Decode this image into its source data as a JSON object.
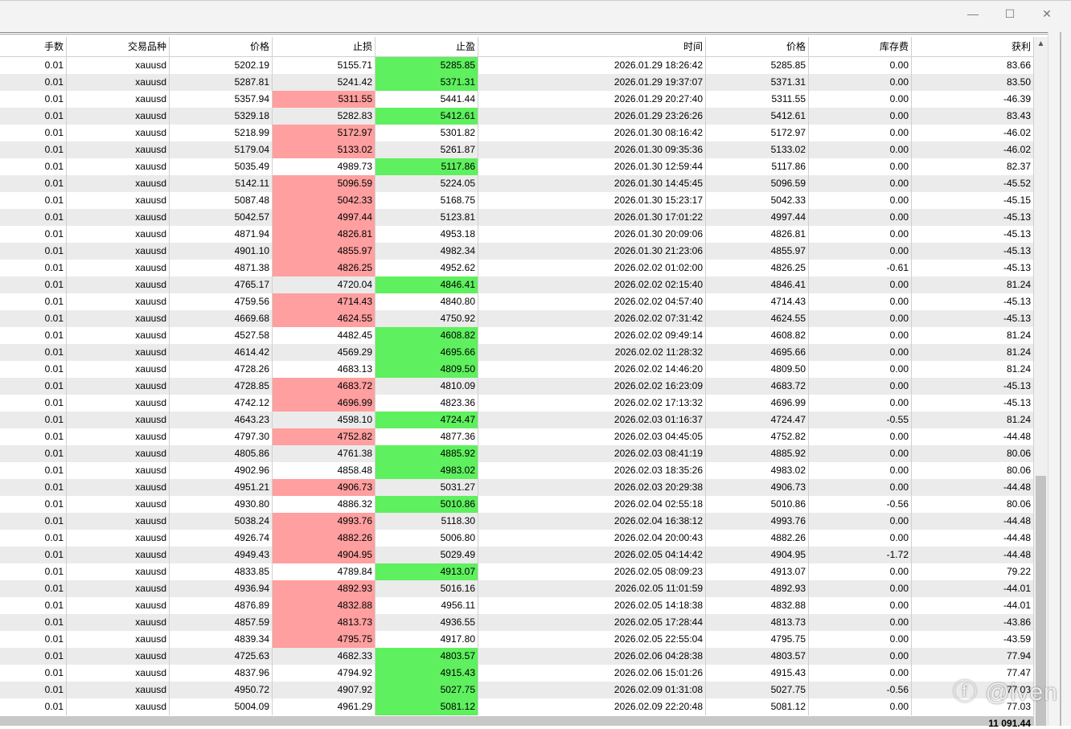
{
  "window": {
    "minimize": "—",
    "maximize": "☐",
    "close": "✕"
  },
  "columns": [
    "手数",
    "交易品种",
    "价格",
    "止损",
    "止盈",
    "时间",
    "价格",
    "库存费",
    "获利"
  ],
  "colors": {
    "red": "#ff9f9f",
    "green": "#5ef05e"
  },
  "rows": [
    [
      "0.01",
      "xauusd",
      "5202.19",
      "5155.71",
      "5285.85",
      "2026.01.29 18:26:42",
      "5285.85",
      "0.00",
      "83.66",
      "tp"
    ],
    [
      "0.01",
      "xauusd",
      "5287.81",
      "5241.42",
      "5371.31",
      "2026.01.29 19:37:07",
      "5371.31",
      "0.00",
      "83.50",
      "tp"
    ],
    [
      "0.01",
      "xauusd",
      "5357.94",
      "5311.55",
      "5441.44",
      "2026.01.29 20:27:40",
      "5311.55",
      "0.00",
      "-46.39",
      "sl"
    ],
    [
      "0.01",
      "xauusd",
      "5329.18",
      "5282.83",
      "5412.61",
      "2026.01.29 23:26:26",
      "5412.61",
      "0.00",
      "83.43",
      "tp"
    ],
    [
      "0.01",
      "xauusd",
      "5218.99",
      "5172.97",
      "5301.82",
      "2026.01.30 08:16:42",
      "5172.97",
      "0.00",
      "-46.02",
      "sl"
    ],
    [
      "0.01",
      "xauusd",
      "5179.04",
      "5133.02",
      "5261.87",
      "2026.01.30 09:35:36",
      "5133.02",
      "0.00",
      "-46.02",
      "sl"
    ],
    [
      "0.01",
      "xauusd",
      "5035.49",
      "4989.73",
      "5117.86",
      "2026.01.30 12:59:44",
      "5117.86",
      "0.00",
      "82.37",
      "tp"
    ],
    [
      "0.01",
      "xauusd",
      "5142.11",
      "5096.59",
      "5224.05",
      "2026.01.30 14:45:45",
      "5096.59",
      "0.00",
      "-45.52",
      "sl"
    ],
    [
      "0.01",
      "xauusd",
      "5087.48",
      "5042.33",
      "5168.75",
      "2026.01.30 15:23:17",
      "5042.33",
      "0.00",
      "-45.15",
      "sl"
    ],
    [
      "0.01",
      "xauusd",
      "5042.57",
      "4997.44",
      "5123.81",
      "2026.01.30 17:01:22",
      "4997.44",
      "0.00",
      "-45.13",
      "sl"
    ],
    [
      "0.01",
      "xauusd",
      "4871.94",
      "4826.81",
      "4953.18",
      "2026.01.30 20:09:06",
      "4826.81",
      "0.00",
      "-45.13",
      "sl"
    ],
    [
      "0.01",
      "xauusd",
      "4901.10",
      "4855.97",
      "4982.34",
      "2026.01.30 21:23:06",
      "4855.97",
      "0.00",
      "-45.13",
      "sl"
    ],
    [
      "0.01",
      "xauusd",
      "4871.38",
      "4826.25",
      "4952.62",
      "2026.02.02 01:02:00",
      "4826.25",
      "-0.61",
      "-45.13",
      "sl"
    ],
    [
      "0.01",
      "xauusd",
      "4765.17",
      "4720.04",
      "4846.41",
      "2026.02.02 02:15:40",
      "4846.41",
      "0.00",
      "81.24",
      "tp"
    ],
    [
      "0.01",
      "xauusd",
      "4759.56",
      "4714.43",
      "4840.80",
      "2026.02.02 04:57:40",
      "4714.43",
      "0.00",
      "-45.13",
      "sl"
    ],
    [
      "0.01",
      "xauusd",
      "4669.68",
      "4624.55",
      "4750.92",
      "2026.02.02 07:31:42",
      "4624.55",
      "0.00",
      "-45.13",
      "sl"
    ],
    [
      "0.01",
      "xauusd",
      "4527.58",
      "4482.45",
      "4608.82",
      "2026.02.02 09:49:14",
      "4608.82",
      "0.00",
      "81.24",
      "tp"
    ],
    [
      "0.01",
      "xauusd",
      "4614.42",
      "4569.29",
      "4695.66",
      "2026.02.02 11:28:32",
      "4695.66",
      "0.00",
      "81.24",
      "tp"
    ],
    [
      "0.01",
      "xauusd",
      "4728.26",
      "4683.13",
      "4809.50",
      "2026.02.02 14:46:20",
      "4809.50",
      "0.00",
      "81.24",
      "tp"
    ],
    [
      "0.01",
      "xauusd",
      "4728.85",
      "4683.72",
      "4810.09",
      "2026.02.02 16:23:09",
      "4683.72",
      "0.00",
      "-45.13",
      "sl"
    ],
    [
      "0.01",
      "xauusd",
      "4742.12",
      "4696.99",
      "4823.36",
      "2026.02.02 17:13:32",
      "4696.99",
      "0.00",
      "-45.13",
      "sl"
    ],
    [
      "0.01",
      "xauusd",
      "4643.23",
      "4598.10",
      "4724.47",
      "2026.02.03 01:16:37",
      "4724.47",
      "-0.55",
      "81.24",
      "tp"
    ],
    [
      "0.01",
      "xauusd",
      "4797.30",
      "4752.82",
      "4877.36",
      "2026.02.03 04:45:05",
      "4752.82",
      "0.00",
      "-44.48",
      "sl"
    ],
    [
      "0.01",
      "xauusd",
      "4805.86",
      "4761.38",
      "4885.92",
      "2026.02.03 08:41:19",
      "4885.92",
      "0.00",
      "80.06",
      "tp"
    ],
    [
      "0.01",
      "xauusd",
      "4902.96",
      "4858.48",
      "4983.02",
      "2026.02.03 18:35:26",
      "4983.02",
      "0.00",
      "80.06",
      "tp"
    ],
    [
      "0.01",
      "xauusd",
      "4951.21",
      "4906.73",
      "5031.27",
      "2026.02.03 20:29:38",
      "4906.73",
      "0.00",
      "-44.48",
      "sl"
    ],
    [
      "0.01",
      "xauusd",
      "4930.80",
      "4886.32",
      "5010.86",
      "2026.02.04 02:55:18",
      "5010.86",
      "-0.56",
      "80.06",
      "tp"
    ],
    [
      "0.01",
      "xauusd",
      "5038.24",
      "4993.76",
      "5118.30",
      "2026.02.04 16:38:12",
      "4993.76",
      "0.00",
      "-44.48",
      "sl"
    ],
    [
      "0.01",
      "xauusd",
      "4926.74",
      "4882.26",
      "5006.80",
      "2026.02.04 20:00:43",
      "4882.26",
      "0.00",
      "-44.48",
      "sl"
    ],
    [
      "0.01",
      "xauusd",
      "4949.43",
      "4904.95",
      "5029.49",
      "2026.02.05 04:14:42",
      "4904.95",
      "-1.72",
      "-44.48",
      "sl"
    ],
    [
      "0.01",
      "xauusd",
      "4833.85",
      "4789.84",
      "4913.07",
      "2026.02.05 08:09:23",
      "4913.07",
      "0.00",
      "79.22",
      "tp"
    ],
    [
      "0.01",
      "xauusd",
      "4936.94",
      "4892.93",
      "5016.16",
      "2026.02.05 11:01:59",
      "4892.93",
      "0.00",
      "-44.01",
      "sl"
    ],
    [
      "0.01",
      "xauusd",
      "4876.89",
      "4832.88",
      "4956.11",
      "2026.02.05 14:18:38",
      "4832.88",
      "0.00",
      "-44.01",
      "sl"
    ],
    [
      "0.01",
      "xauusd",
      "4857.59",
      "4813.73",
      "4936.55",
      "2026.02.05 17:28:44",
      "4813.73",
      "0.00",
      "-43.86",
      "sl"
    ],
    [
      "0.01",
      "xauusd",
      "4839.34",
      "4795.75",
      "4917.80",
      "2026.02.05 22:55:04",
      "4795.75",
      "0.00",
      "-43.59",
      "sl"
    ],
    [
      "0.01",
      "xauusd",
      "4725.63",
      "4682.33",
      "4803.57",
      "2026.02.06 04:28:38",
      "4803.57",
      "0.00",
      "77.94",
      "tp"
    ],
    [
      "0.01",
      "xauusd",
      "4837.96",
      "4794.92",
      "4915.43",
      "2026.02.06 15:01:26",
      "4915.43",
      "0.00",
      "77.47",
      "tp"
    ],
    [
      "0.01",
      "xauusd",
      "4950.72",
      "4907.92",
      "5027.75",
      "2026.02.09 01:31:08",
      "5027.75",
      "-0.56",
      "77.03",
      "tp"
    ],
    [
      "0.01",
      "xauusd",
      "5004.09",
      "4961.29",
      "5081.12",
      "2026.02.09 22:20:48",
      "5081.12",
      "0.00",
      "77.03",
      "tp"
    ]
  ],
  "total": "11 091.44",
  "watermark": "ⓕ @iven"
}
